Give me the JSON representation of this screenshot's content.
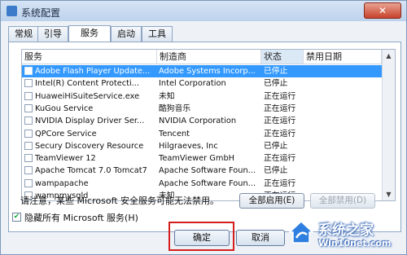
{
  "window": {
    "title": "系统配置",
    "close_glyph": "✕"
  },
  "tabs": [
    {
      "label": "常规"
    },
    {
      "label": "引导"
    },
    {
      "label": "服务"
    },
    {
      "label": "启动"
    },
    {
      "label": "工具"
    }
  ],
  "active_tab": "服务",
  "table": {
    "columns": [
      "服务",
      "制造商",
      "状态",
      "禁用日期"
    ],
    "rows": [
      {
        "service": "Adobe Flash Player Update...",
        "maker": "Adobe Systems Incorp...",
        "status": "已停止",
        "selected": true
      },
      {
        "service": "Intel(R) Content Protecti...",
        "maker": "Intel Corporation",
        "status": "已停止"
      },
      {
        "service": "HuaweiHiSuiteService.exe",
        "maker": "未知",
        "status": "正在运行"
      },
      {
        "service": "KuGou Service",
        "maker": "酷狗音乐",
        "status": "正在运行"
      },
      {
        "service": "NVIDIA Display Driver Ser...",
        "maker": "NVIDIA Corporation",
        "status": "正在运行"
      },
      {
        "service": "QPCore Service",
        "maker": "Tencent",
        "status": "正在运行"
      },
      {
        "service": "Secury Discovery Resource",
        "maker": "Hilgraeves, Inc",
        "status": "已停止"
      },
      {
        "service": "TeamViewer 12",
        "maker": "TeamViewer GmbH",
        "status": "正在运行"
      },
      {
        "service": "Apache Tomcat 7.0 Tomcat7",
        "maker": "Apache Software Foun...",
        "status": "已停止"
      },
      {
        "service": "wampapache",
        "maker": "Apache Software Foun...",
        "status": "正在运行"
      },
      {
        "service": "wampmysqld",
        "maker": "未知",
        "status": "正在运行"
      }
    ]
  },
  "note": "请注意，某些 Microsoft 安全服务可能无法禁用。",
  "buttons": {
    "enable_all": "全部启用(E)",
    "disable_all": "全部禁用(D)",
    "ok": "确定",
    "cancel": "取消"
  },
  "hide_ms": {
    "label": "隐藏所有 Microsoft 服务(H)",
    "checked": true
  },
  "watermark": {
    "text": "系统之家",
    "url": "Win10net.com"
  }
}
